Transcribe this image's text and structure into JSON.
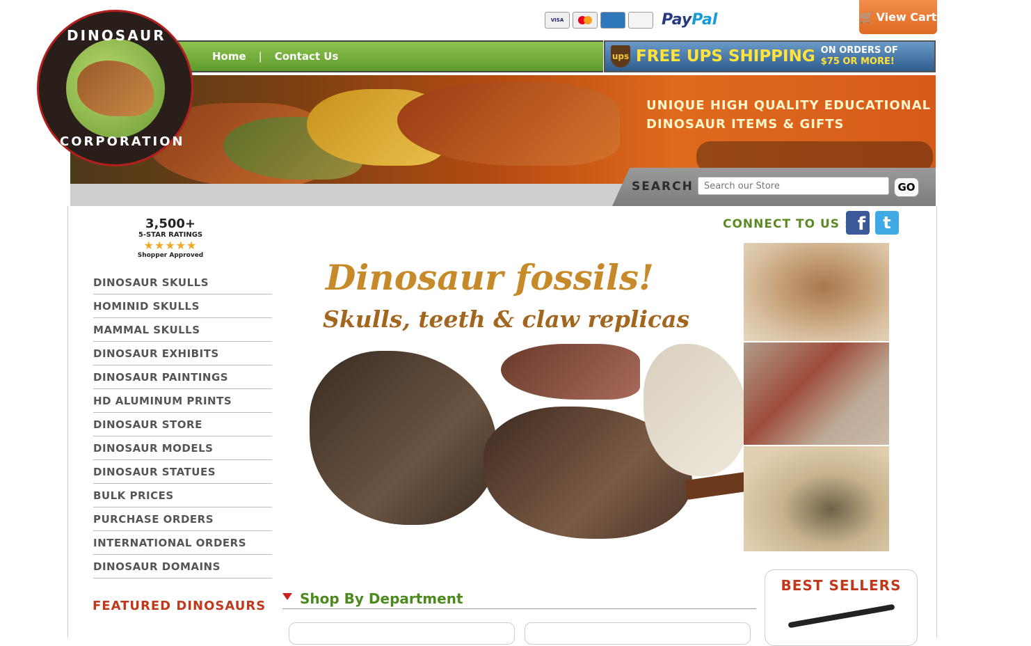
{
  "header": {
    "cards": [
      "VISA",
      "MasterCard",
      "AMERICAN EXPRESS",
      "DISCOVER"
    ],
    "paypal_a": "Pay",
    "paypal_b": "Pal",
    "view_cart": "View Cart"
  },
  "logo": {
    "top": "DINOSAUR",
    "bottom": "CORPORATION"
  },
  "nav": {
    "home": "Home",
    "separator": "|",
    "contact": "Contact Us"
  },
  "ups": {
    "logo": "ups",
    "headline": "FREE UPS SHIPPING",
    "line1": "ON ORDERS OF",
    "line2": "$75 OR MORE!"
  },
  "banner": {
    "line1": "UNIQUE HIGH QUALITY EDUCATIONAL",
    "line2": "DINOSAUR ITEMS & GIFTS"
  },
  "search": {
    "label": "SEARCH",
    "placeholder": "Search our Store",
    "go": "GO"
  },
  "rating": {
    "count": "3,500+",
    "label": "5-STAR RATINGS",
    "stars": "★★★★★",
    "badge": "Shopper Approved"
  },
  "sidebar": {
    "items": [
      "DINOSAUR SKULLS",
      "HOMINID SKULLS",
      "MAMMAL SKULLS",
      "DINOSAUR EXHIBITS",
      "DINOSAUR PAINTINGS",
      "HD ALUMINUM PRINTS",
      "DINOSAUR STORE",
      "DINOSAUR MODELS",
      "DINOSAUR STATUES",
      "BULK PRICES",
      "PURCHASE ORDERS",
      "INTERNATIONAL ORDERS",
      "DINOSAUR DOMAINS"
    ],
    "featured": "FEATURED DINOSAURS"
  },
  "social": {
    "connect": "CONNECT TO US :",
    "facebook": "f",
    "twitter": "t"
  },
  "hero": {
    "title": "Dinosaur fossils!",
    "subtitle": "Skulls, teeth & claw replicas"
  },
  "shop": {
    "title": "Shop By Department"
  },
  "bestsellers": {
    "title": "BEST SELLERS"
  },
  "colors": {
    "nav_green": "#6fa83a",
    "accent_orange": "#e8762e",
    "title_red": "#c0391b",
    "shop_green": "#4c8a1e"
  }
}
